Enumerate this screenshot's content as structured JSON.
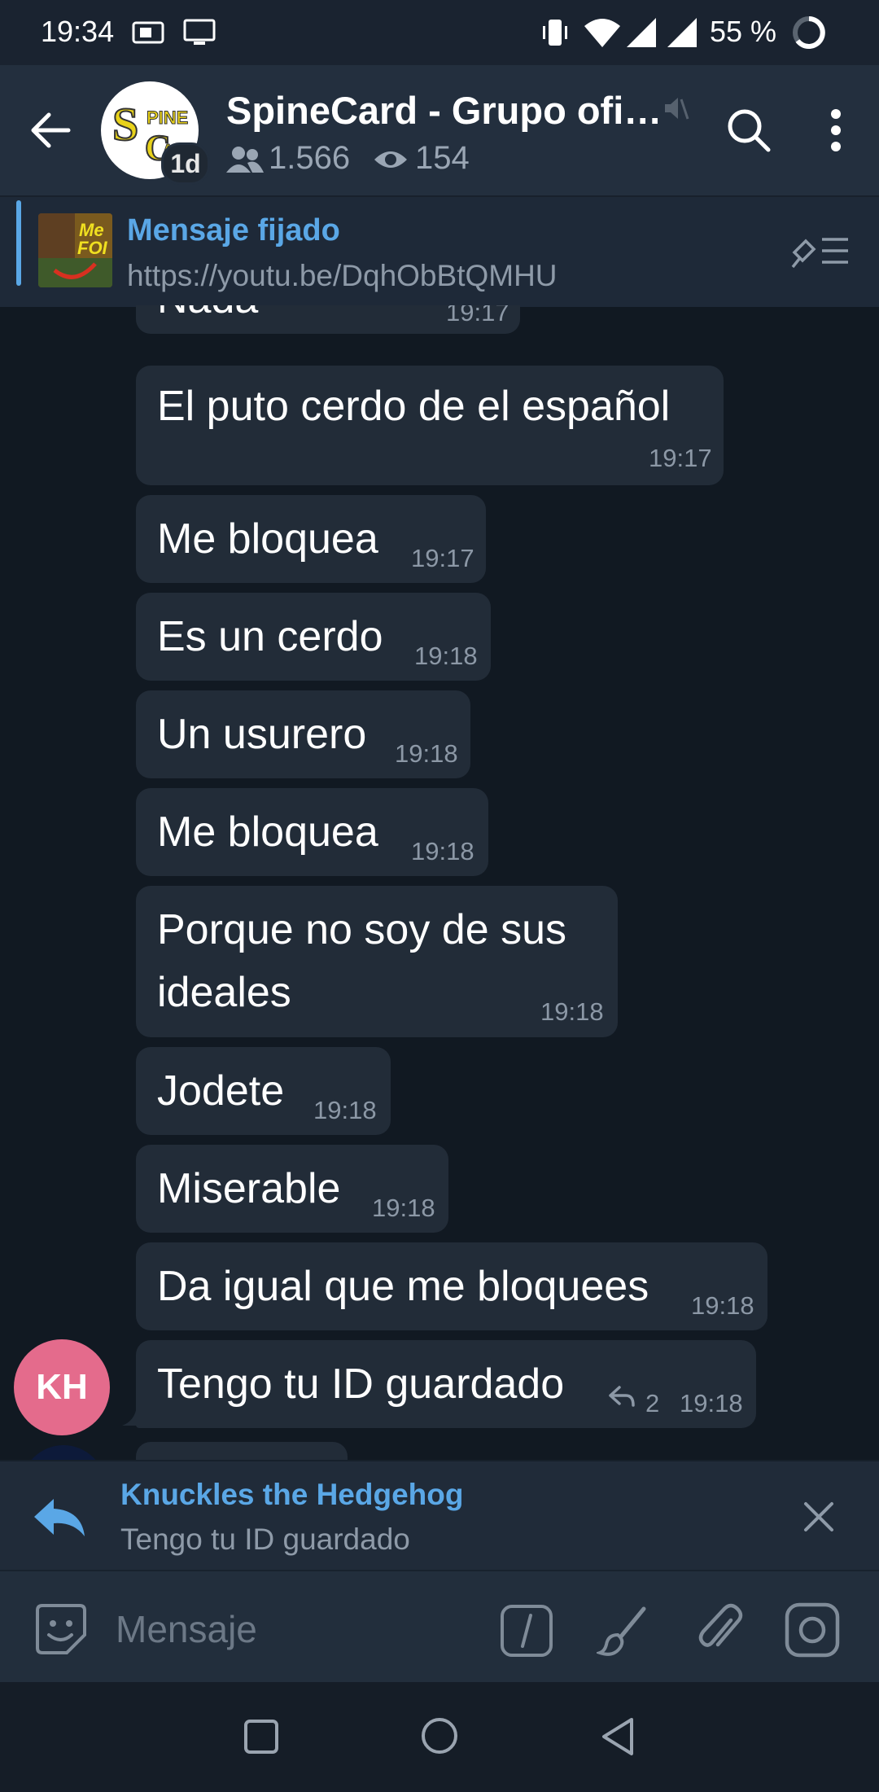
{
  "status_bar": {
    "time": "19:34",
    "battery_percent": "55 %"
  },
  "header": {
    "title": "SpineCard - Grupo ofi…",
    "avatar_badge": "1d",
    "members": "1.566",
    "views": "154"
  },
  "pinned": {
    "label": "Mensaje fijado",
    "url": "https://youtu.be/DqhObBtQMHU"
  },
  "messages": [
    {
      "text": "Nada",
      "time": "19:17"
    },
    {
      "text": "El puto cerdo de el español",
      "time": "19:17"
    },
    {
      "text": "Me bloquea",
      "time": "19:17"
    },
    {
      "text": "Es un cerdo",
      "time": "19:18"
    },
    {
      "text": "Un usurero",
      "time": "19:18"
    },
    {
      "text": "Me bloquea",
      "time": "19:18"
    },
    {
      "text": "Porque no soy de sus",
      "text2": "ideales",
      "time": "19:18"
    },
    {
      "text": "Jodete",
      "time": "19:18"
    },
    {
      "text": "Miserable",
      "time": "19:18"
    },
    {
      "text": "Da igual que me bloquees",
      "time": "19:18"
    },
    {
      "text": "Tengo tu ID guardado",
      "time": "19:18",
      "replies": "2"
    }
  ],
  "sender_avatar": {
    "initials": "KH"
  },
  "reply": {
    "name": "Knuckles the Hedgehog",
    "preview": "Tengo tu ID guardado"
  },
  "composer": {
    "placeholder": "Mensaje"
  },
  "colors": {
    "accent": "#5aa7e6",
    "bubble": "#222c38",
    "background": "#111922",
    "avatar_kh": "#e46b8c"
  }
}
